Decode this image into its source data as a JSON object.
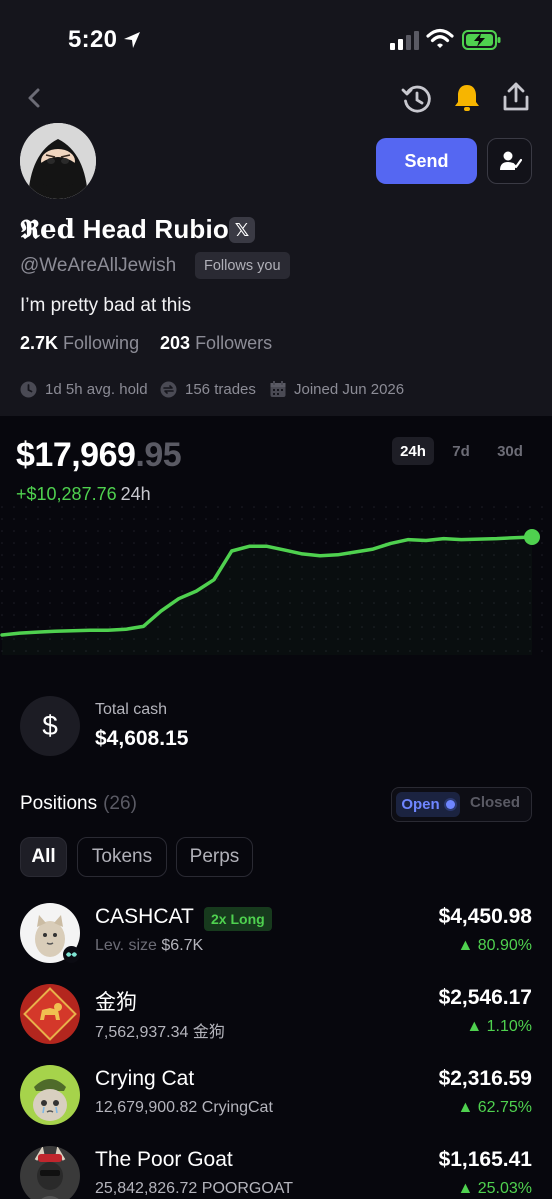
{
  "status_bar": {
    "time": "5:20"
  },
  "profile": {
    "name_fancy": "𝕽ed",
    "name_rest": " Head Rubio",
    "x_badge": "𝕏",
    "handle": "@WeAreAllJewish",
    "follows_badge": "Follows you",
    "bio": "I’m pretty bad at this",
    "following_count": "2.7K",
    "following_label": "Following",
    "followers_count": "203",
    "followers_label": "Followers",
    "avg_hold": "1d 5h avg. hold",
    "trades": "156 trades",
    "joined": "Joined Jun 2026"
  },
  "actions": {
    "send_label": "Send"
  },
  "portfolio": {
    "balance_main": "$17,969",
    "balance_cents": ".95",
    "change_value": "+$10,287.76",
    "change_period": "24h",
    "ranges": [
      "24h",
      "7d",
      "30d"
    ],
    "active_range": "24h"
  },
  "chart_data": {
    "type": "line",
    "title": "",
    "xlabel": "",
    "ylabel": "",
    "x": [
      0,
      1,
      2,
      3,
      4,
      5,
      6,
      7,
      8,
      9,
      10,
      11,
      12,
      13,
      14,
      15,
      16,
      17,
      18,
      19,
      20,
      21,
      22,
      23,
      24,
      25,
      26,
      27,
      28,
      29,
      30
    ],
    "values": [
      7700,
      7900,
      8000,
      8100,
      8150,
      8200,
      8200,
      8300,
      8600,
      10200,
      11500,
      12300,
      13500,
      16500,
      17000,
      17000,
      16600,
      16200,
      16000,
      16100,
      16400,
      16700,
      17300,
      17700,
      17600,
      17800,
      17700,
      17750,
      17800,
      17900,
      17969.95
    ],
    "line_color": "#4fd14f",
    "grid": false
  },
  "cash": {
    "icon": "$",
    "label": "Total cash",
    "value": "$4,608.15"
  },
  "positions": {
    "title": "Positions",
    "count": "(26)",
    "toggle_open": "Open",
    "toggle_closed": "Closed",
    "filters": [
      "All",
      "Tokens",
      "Perps"
    ],
    "items": [
      {
        "name": "CASHCAT",
        "badge": "2x Long",
        "sub_label": "Lev. size",
        "sub_value": "$6.7K",
        "value": "$4,450.98",
        "change": "▲ 80.90%"
      },
      {
        "name": "金狗",
        "sub_value": "7,562,937.34 金狗",
        "value": "$2,546.17",
        "change": "▲ 1.10%"
      },
      {
        "name": "Crying Cat",
        "sub_value": "12,679,900.82 CryingCat",
        "value": "$2,316.59",
        "change": "▲ 62.75%"
      },
      {
        "name": "The Poor Goat",
        "sub_value": "25,842,826.72 POORGOAT",
        "value": "$1,165.41",
        "change": "▲ 25.03%"
      }
    ]
  },
  "colors": {
    "accent": "#5567f2",
    "positive": "#4fd14f",
    "bell": "#f7b500"
  }
}
